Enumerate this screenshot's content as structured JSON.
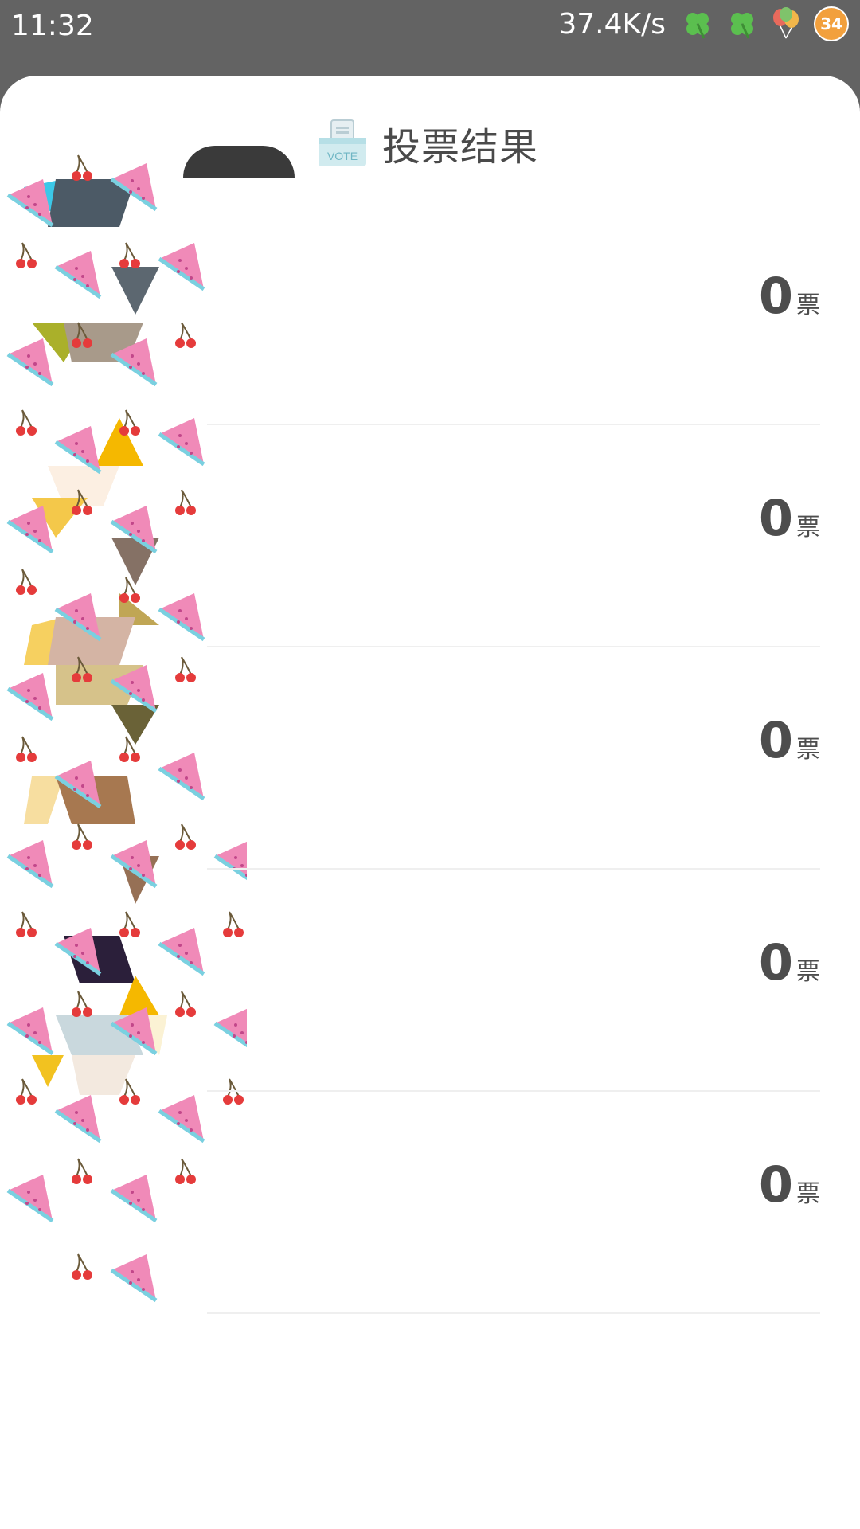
{
  "status_bar": {
    "time": "11:32",
    "net_speed": "37.4K/s",
    "icons": [
      "clover-icon",
      "clover-icon",
      "balloons-icon",
      "cat-badge-icon"
    ],
    "badge_count": "34"
  },
  "header": {
    "icon_name": "vote-box-icon",
    "icon_text": "VOTE",
    "title": "投票结果"
  },
  "results": [
    {
      "count": "0",
      "unit": "票"
    },
    {
      "count": "0",
      "unit": "票"
    },
    {
      "count": "0",
      "unit": "票"
    },
    {
      "count": "0",
      "unit": "票"
    },
    {
      "count": "0",
      "unit": "票"
    }
  ],
  "colors": {
    "status_bg": "#636363",
    "sheet_bg": "#ffffff",
    "text_dark": "#4d4d4d",
    "watermelon": "#f08ab8",
    "cherry": "#e53b3b"
  }
}
